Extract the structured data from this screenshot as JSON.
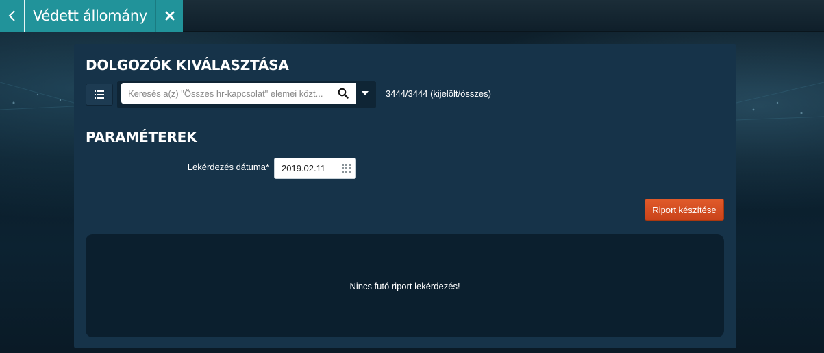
{
  "header": {
    "title": "Védett állomány",
    "back_icon": "chevron-left-icon",
    "close_icon": "close-icon",
    "accent_color": "#21939a"
  },
  "employees": {
    "section_title": "DOLGOZÓK KIVÁLASZTÁSA",
    "list_icon": "list-icon",
    "search": {
      "placeholder": "Keresés a(z) \"Összes hr-kapcsolat\" elemei közt...",
      "value": "",
      "icon": "search-icon"
    },
    "dropdown_icon": "caret-down-icon",
    "count_text": "3444/3444 (kijelölt/összes)"
  },
  "parameters": {
    "section_title": "PARAMÉTEREK",
    "date_label": "Lekérdezés dátuma*",
    "date_value": "2019.02.11",
    "calendar_icon": "calendar-icon"
  },
  "actions": {
    "report_button": "Riport készítése",
    "button_color": "#d84f22"
  },
  "result": {
    "message": "Nincs futó riport lekérdezés!"
  }
}
